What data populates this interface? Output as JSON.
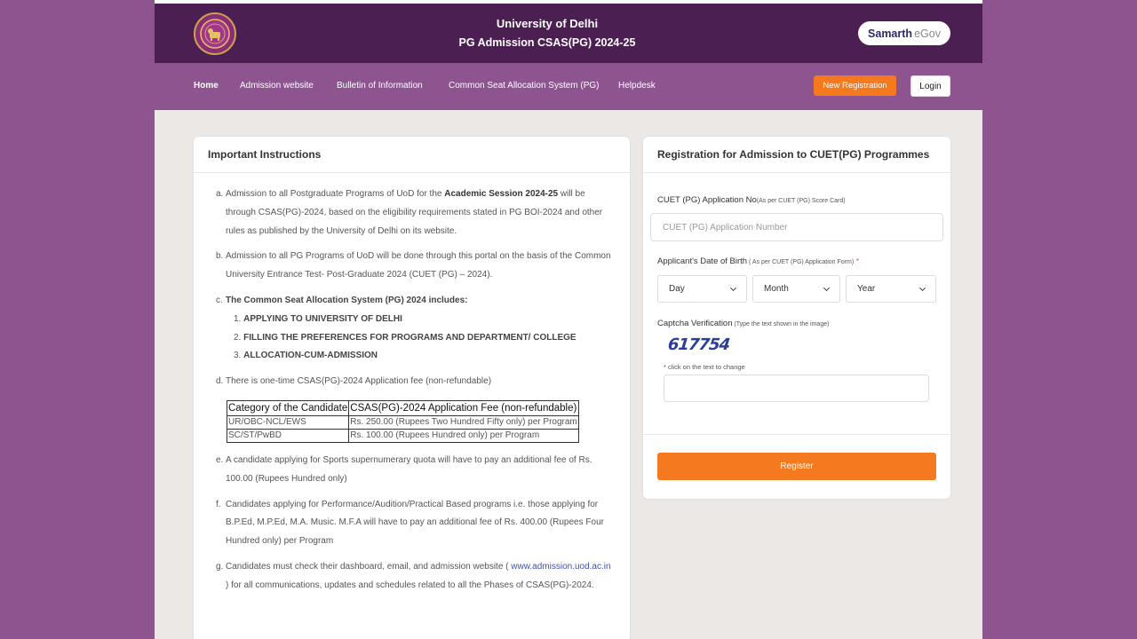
{
  "header": {
    "title": "University of Delhi",
    "subtitle": "PG Admission CSAS(PG) 2024-25",
    "brand_main": "Samarth",
    "brand_suffix": "eGov",
    "logo_icon": "university-seal-icon"
  },
  "nav": {
    "items": [
      "Home",
      "Admission website",
      "Bulletin of Information",
      "Common Seat Allocation System (PG)",
      "Helpdesk"
    ],
    "new_registration": "New Registration",
    "login": "Login"
  },
  "instructions": {
    "title": "Important Instructions",
    "a": {
      "marker": "a.",
      "pre": "Admission to all Postgraduate Programs of UoD for the ",
      "bold": "Academic Session 2024-25",
      "post": " will be through CSAS(PG)-2024, based on the eligibility requirements stated in PG BOI-2024 and other rules as published by the University of Delhi on its website."
    },
    "b": {
      "marker": "b.",
      "text": "Admission to all PG Programs of UoD will be done through this portal on the basis of the Common University Entrance Test- Post-Graduate 2024 (CUET (PG) – 2024)."
    },
    "c": {
      "marker": "c.",
      "text": "The Common Seat Allocation System (PG) 2024 includes:",
      "sub_items": [
        {
          "marker": "1.",
          "text": "APPLYING TO UNIVERSITY OF DELHI"
        },
        {
          "marker": "2.",
          "text": "FILLING THE PREFERENCES FOR PROGRAMS AND DEPARTMENT/ COLLEGE"
        },
        {
          "marker": "3.",
          "text": "ALLOCATION-CUM-ADMISSION"
        }
      ]
    },
    "d": {
      "marker": "d.",
      "text": "There is one-time CSAS(PG)-2024 Application fee  (non-refundable)"
    },
    "fee_table": {
      "headers": [
        "Category of the Candidate",
        "CSAS(PG)-2024 Application Fee (non-refundable)"
      ],
      "rows": [
        [
          "UR/OBC-NCL/EWS",
          "Rs. 250.00 (Rupees Two Hundred Fifty only) per Program"
        ],
        [
          "SC/ST/PwBD",
          "Rs. 100.00 (Rupees Hundred only) per Program"
        ]
      ]
    },
    "e": {
      "marker": "e.",
      "text": "A candidate applying for Sports supernumerary quota will have to pay an additional fee of Rs. 100.00 (Rupees Hundred only)"
    },
    "f": {
      "marker": "f.",
      "text": "Candidates applying for Performance/Audition/Practical Based programs i.e. those applying for B.P.Ed, M.P.Ed, M.A. Music. M.F.A will have to pay an additional fee of Rs. 400.00 (Rupees Four Hundred only) per Program"
    },
    "g": {
      "marker": "g.",
      "pre": "Candidates must check their dashboard, email, and admission website ( ",
      "link": "www.admission.uod.ac.in",
      "post": " ) for all communications, updates and schedules related to all the Phases of CSAS(PG)-2024."
    }
  },
  "registration": {
    "title": "Registration for Admission to CUET(PG) Programmes",
    "app_no_label": "CUET (PG) Application No",
    "app_no_note": "(As per CUET (PG) Score Card)",
    "app_no_placeholder": "CUET (PG) Application Number",
    "dob_label": "Applicant's Date of Birth",
    "dob_note": " ( As per CUET (PG) Application Form)",
    "required_mark": "*",
    "day": "Day",
    "month": "Month",
    "year": "Year",
    "captcha_label": "Captcha Verification",
    "captcha_note": " (Type the text shown in the image)",
    "captcha_text": "617754",
    "captcha_hint": "* click on the text to change",
    "captcha_value": "",
    "register_label": "Register"
  }
}
